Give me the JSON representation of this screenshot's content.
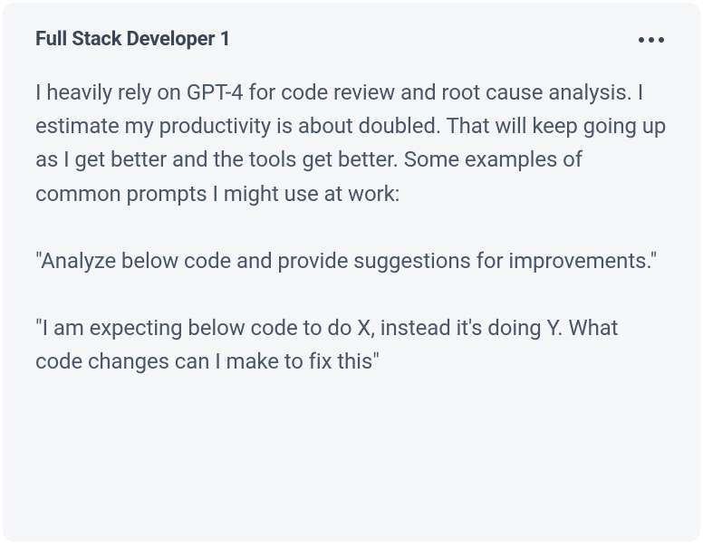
{
  "post": {
    "author": "Full Stack Developer 1",
    "paragraphs": [
      "I heavily rely on GPT-4 for code review and root cause analysis. I estimate my productivity is about doubled. That will keep going up as I get better and the tools get better. Some examples of common prompts I might use at work:",
      "\"Analyze below code and provide suggestions for improvements.\"",
      "\"I am expecting below code to do X, instead it's doing Y. What code changes can I make to fix this\""
    ]
  }
}
